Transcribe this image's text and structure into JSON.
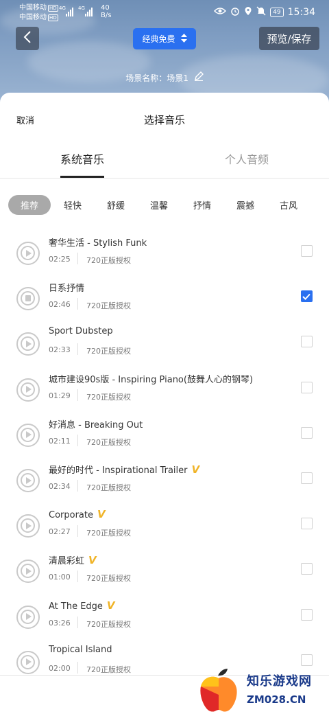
{
  "status_bar": {
    "carrier1": "中国移动",
    "carrier2": "中国移动",
    "hd_badge": "HD",
    "net_type": "4G",
    "speed_value": "40",
    "speed_unit": "B/s",
    "battery": "49",
    "time": "15:34"
  },
  "header": {
    "back_icon": "chevron-left-icon",
    "mode_label": "经典免费",
    "save_label": "预览/保存",
    "scene_text": "场景名称：场景1"
  },
  "picker": {
    "cancel_label": "取消",
    "title": "选择音乐",
    "tabs": [
      {
        "label": "系统音乐",
        "active": true
      },
      {
        "label": "个人音频",
        "active": false
      }
    ],
    "categories": [
      {
        "label": "推荐",
        "active": true
      },
      {
        "label": "轻快"
      },
      {
        "label": "舒缓"
      },
      {
        "label": "温馨"
      },
      {
        "label": "抒情"
      },
      {
        "label": "震撼"
      },
      {
        "label": "古风"
      }
    ],
    "vip_mark": "V",
    "tracks": [
      {
        "title": "奢华生活 - Stylish Funk",
        "duration": "02:25",
        "license": "720正版授权",
        "vip": false,
        "playing": false,
        "checked": false
      },
      {
        "title": "日系抒情",
        "duration": "02:46",
        "license": "720正版授权",
        "vip": false,
        "playing": true,
        "checked": true
      },
      {
        "title": "Sport Dubstep",
        "duration": "02:33",
        "license": "720正版授权",
        "vip": false,
        "playing": false,
        "checked": false
      },
      {
        "title": "城市建设90s版 - Inspiring Piano(鼓舞人心的钢琴)",
        "duration": "01:29",
        "license": "720正版授权",
        "vip": false,
        "playing": false,
        "checked": false
      },
      {
        "title": "好消息 - Breaking Out",
        "duration": "02:11",
        "license": "720正版授权",
        "vip": false,
        "playing": false,
        "checked": false
      },
      {
        "title": "最好的时代 - Inspirational Trailer",
        "duration": "02:34",
        "license": "720正版授权",
        "vip": true,
        "playing": false,
        "checked": false
      },
      {
        "title": "Corporate",
        "duration": "02:27",
        "license": "720正版授权",
        "vip": true,
        "playing": false,
        "checked": false
      },
      {
        "title": "清晨彩虹",
        "duration": "01:00",
        "license": "720正版授权",
        "vip": true,
        "playing": false,
        "checked": false
      },
      {
        "title": "At The Edge",
        "duration": "03:26",
        "license": "720正版授权",
        "vip": true,
        "playing": false,
        "checked": false
      },
      {
        "title": "Tropical Island",
        "duration": "02:00",
        "license": "720正版授权",
        "vip": false,
        "playing": false,
        "checked": false
      }
    ]
  },
  "watermark": {
    "text": "知乐游戏网",
    "url": "ZM028.CN"
  },
  "colors": {
    "accent": "#2a70f0",
    "vip": "#f0b428",
    "active_chip": "#a9a9a9"
  }
}
